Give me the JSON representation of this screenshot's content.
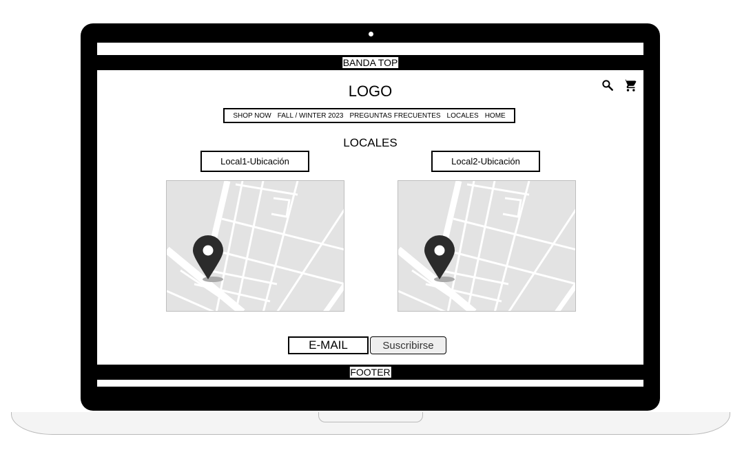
{
  "banner": {
    "label": "BANDA TOP"
  },
  "header": {
    "logo": "LOGO",
    "icons": [
      "search-icon",
      "cart-icon"
    ]
  },
  "nav": {
    "items": [
      "SHOP NOW",
      "FALL / WINTER 2023",
      "PREGUNTAS FRECUENTES",
      "LOCALES",
      "HOME"
    ]
  },
  "main": {
    "title": "LOCALES",
    "locations": [
      {
        "label": "Local1-Ubicación"
      },
      {
        "label": "Local2-Ubicación"
      }
    ]
  },
  "newsletter": {
    "email_placeholder": "E-MAIL",
    "subscribe_label": "Suscribirse"
  },
  "footer": {
    "label": "FOOTER"
  },
  "colors": {
    "frame": "#000000",
    "map_bg": "#e3e3e3",
    "map_roads": "#ffffff",
    "pin": "#2b2b2b"
  }
}
